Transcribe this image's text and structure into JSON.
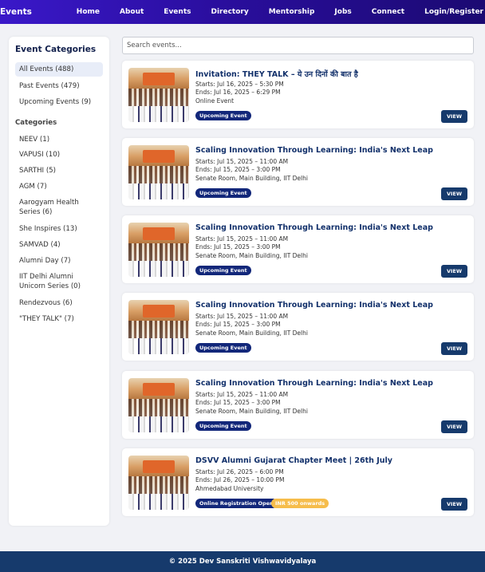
{
  "header": {
    "brand": "Events",
    "nav": [
      "Home",
      "About",
      "Events",
      "Directory",
      "Mentorship",
      "Jobs",
      "Connect",
      "Login/Register"
    ]
  },
  "sidebar": {
    "title": "Event Categories",
    "filters": [
      "All Events (488)",
      "Past Events (479)",
      "Upcoming Events (9)"
    ],
    "categories_heading": "Categories",
    "categories": [
      "NEEV (1)",
      "VAPUSI (10)",
      "SARTHI (5)",
      "AGM (7)",
      "Aarogyam Health Series (6)",
      "She Inspires (13)",
      "SAMVAD (4)",
      "Alumni Day (7)",
      "IIT Delhi Alumni Unicorn Series (0)",
      "Rendezvous (6)",
      "\"THEY TALK\" (7)"
    ]
  },
  "search": {
    "placeholder": "Search events..."
  },
  "events": [
    {
      "title": "Invitation: THEY TALK – ये उन दिनों की बात है",
      "starts": "Starts: Jul 16, 2025 – 5:30 PM",
      "ends": "Ends: Jul 16, 2025 – 6:29 PM",
      "location": "Online Event",
      "badge": "Upcoming Event",
      "badge2": "",
      "button": "VIEW"
    },
    {
      "title": "Scaling Innovation Through Learning: India's Next Leap",
      "starts": "Starts: Jul 15, 2025 – 11:00 AM",
      "ends": "Ends: Jul 15, 2025 – 3:00 PM",
      "location": "Senate Room, Main Building, IIT Delhi",
      "badge": "Upcoming Event",
      "badge2": "",
      "button": "VIEW"
    },
    {
      "title": "Scaling Innovation Through Learning: India's Next Leap",
      "starts": "Starts: Jul 15, 2025 – 11:00 AM",
      "ends": "Ends: Jul 15, 2025 – 3:00 PM",
      "location": "Senate Room, Main Building, IIT Delhi",
      "badge": "Upcoming Event",
      "badge2": "",
      "button": "VIEW"
    },
    {
      "title": "Scaling Innovation Through Learning: India's Next Leap",
      "starts": "Starts: Jul 15, 2025 – 11:00 AM",
      "ends": "Ends: Jul 15, 2025 – 3:00 PM",
      "location": "Senate Room, Main Building, IIT Delhi",
      "badge": "Upcoming Event",
      "badge2": "",
      "button": "VIEW"
    },
    {
      "title": "Scaling Innovation Through Learning: India's Next Leap",
      "starts": "Starts: Jul 15, 2025 – 11:00 AM",
      "ends": "Ends: Jul 15, 2025 – 3:00 PM",
      "location": "Senate Room, Main Building, IIT Delhi",
      "badge": "Upcoming Event",
      "badge2": "",
      "button": "VIEW"
    },
    {
      "title": "DSVV Alumni Gujarat Chapter Meet | 26th July",
      "starts": "Starts: Jul 26, 2025 – 6:00 PM",
      "ends": "Ends: Jul 26, 2025 – 10:00 PM",
      "location": "Ahmedabad University",
      "badge": "Online Registration Open",
      "badge2": "INR 500 onwards",
      "button": "VIEW"
    }
  ],
  "footer": {
    "text": "© 2025 Dev Sanskriti Vishwavidyalaya"
  },
  "colors": {
    "nav_gradient_start": "#3a18c9",
    "nav_gradient_end": "#1b0a72",
    "accent": "#163a6c",
    "badge": "#12277a",
    "badge_amber": "#f6bd4c"
  }
}
